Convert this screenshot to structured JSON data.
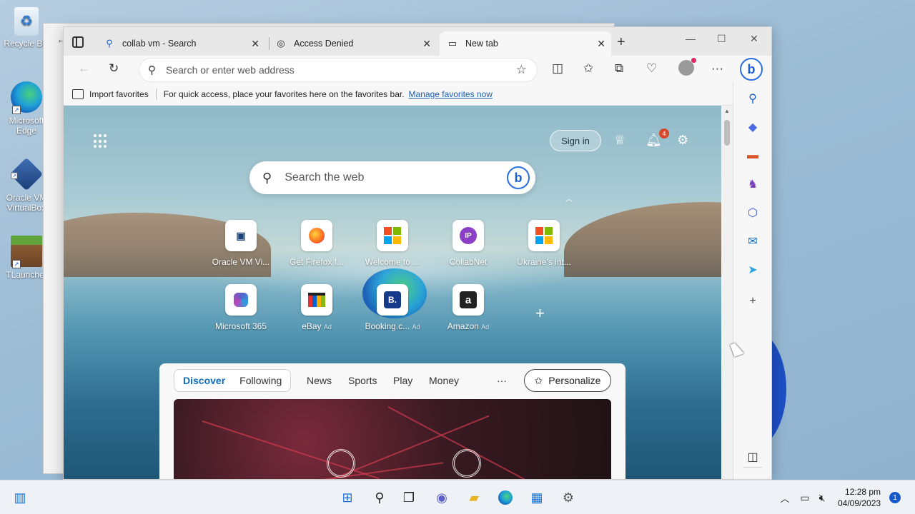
{
  "desktop": {
    "icons": [
      {
        "label": "Recycle Bin"
      },
      {
        "label": "Microsoft Edge"
      },
      {
        "label": "Oracle VM VirtualBox"
      },
      {
        "label": "TLauncher"
      }
    ]
  },
  "browser": {
    "tabs": [
      {
        "label": "collab vm - Search",
        "icon": "search-icon"
      },
      {
        "label": "Access Denied",
        "icon": "page-icon"
      },
      {
        "label": "New tab",
        "icon": "newtab-icon"
      }
    ],
    "address_placeholder": "Search or enter web address",
    "favorites_bar": {
      "import_label": "Import favorites",
      "hint": "For quick access, place your favorites here on the favorites bar.",
      "manage_link": "Manage favorites now"
    }
  },
  "newtab": {
    "signin_label": "Sign in",
    "notification_count": "4",
    "search_placeholder": "Search the web",
    "tiles": [
      {
        "name": "Oracle VM Vi...",
        "icon": "virtualbox-icon"
      },
      {
        "name": "Get Firefox f...",
        "icon": "firefox-icon"
      },
      {
        "name": "Welcome to ...",
        "icon": "microsoft-icon"
      },
      {
        "name": "CollabNet",
        "icon_text": "IP",
        "icon": "ip-icon"
      },
      {
        "name": "Ukraine's int...",
        "icon": "microsoft-icon"
      },
      {
        "name": "Microsoft 365",
        "icon": "m365-icon"
      },
      {
        "name": "eBay",
        "ad": "Ad",
        "icon": "ebay-icon"
      },
      {
        "name": "Booking.c...",
        "ad": "Ad",
        "icon_text": "B.",
        "icon": "booking-icon"
      },
      {
        "name": "Amazon",
        "ad": "Ad",
        "icon_text": "a",
        "icon": "amazon-icon"
      }
    ],
    "feed": {
      "tabs": [
        "Discover",
        "Following"
      ],
      "categories": [
        "News",
        "Sports",
        "Play",
        "Money"
      ],
      "more": "···",
      "personalize_label": "Personalize"
    }
  },
  "taskbar": {
    "time": "12:28 pm",
    "date": "04/09/2023",
    "notification_count": "1"
  }
}
